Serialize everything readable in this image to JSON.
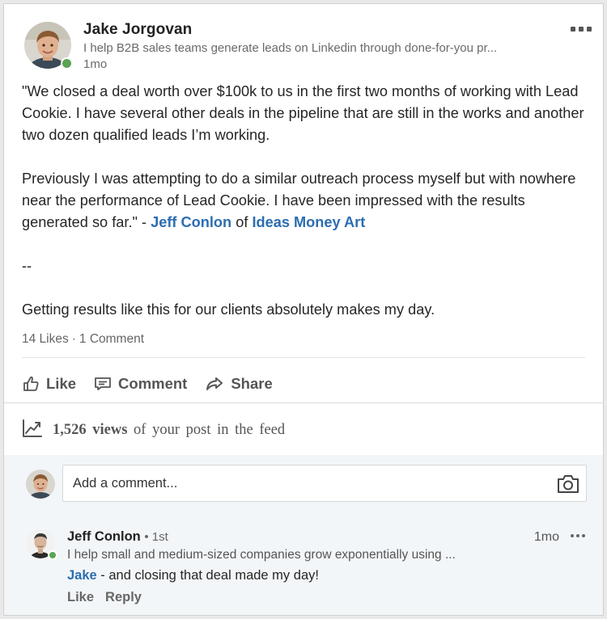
{
  "post": {
    "author": {
      "name": "Jake Jorgovan",
      "headline": "I help B2B sales teams generate leads on Linkedin through done-for-you pr...",
      "time": "1mo"
    },
    "body": {
      "p1": "\"We closed a deal worth over $100k to us in the first two months of working with Lead Cookie. I have several other deals in the pipeline that are still in the works and another two dozen qualified leads I’m working.",
      "p2_text": "Previously I was attempting to do a similar outreach process myself but with nowhere near the performance of Lead Cookie. I have been impressed with the results generated so far.\"  - ",
      "p2_person": "Jeff Conlon",
      "p2_of": " of ",
      "p2_company": "Ideas Money Art",
      "separator": "--",
      "p3": "Getting results like this for our clients absolutely makes my day."
    },
    "social": {
      "likes": "14 Likes",
      "dot": "·",
      "comments": "1 Comment"
    },
    "actions": {
      "like": "Like",
      "comment": "Comment",
      "share": "Share"
    },
    "views": {
      "count": "1,526",
      "label": "views",
      "suffix": "of your post in the feed"
    }
  },
  "comment_box": {
    "placeholder": "Add a comment..."
  },
  "comment": {
    "name": "Jeff Conlon",
    "degree": "• 1st",
    "headline": "I help small and medium-sized companies grow exponentially using ...",
    "time": "1mo",
    "mention": "Jake",
    "text": " - and closing that deal made my day!",
    "like": "Like",
    "reply": "Reply"
  },
  "colors": {
    "link": "#2c6db0",
    "online": "#5aa454",
    "comment_bg": "#f3f6f8"
  },
  "icons": [
    "more-icon",
    "like-icon",
    "comment-icon",
    "share-icon",
    "views-chart-icon",
    "camera-icon"
  ]
}
